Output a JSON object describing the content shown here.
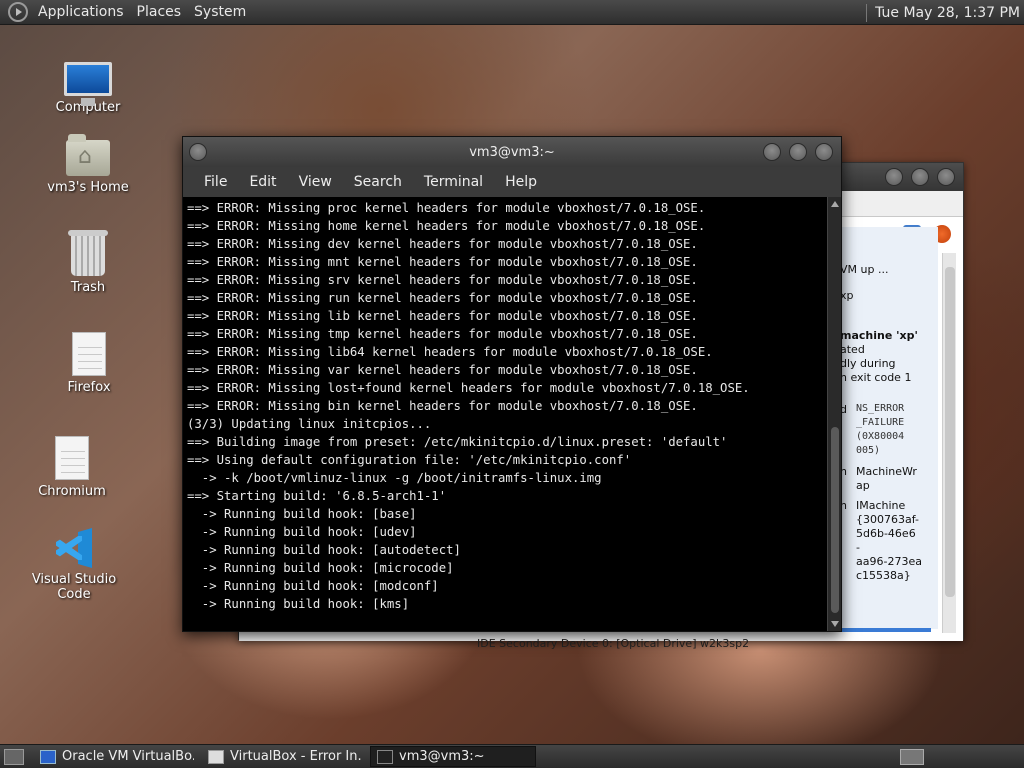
{
  "top_panel": {
    "applications": "Applications",
    "places": "Places",
    "system": "System",
    "clock": "Tue May 28,  1:37 PM"
  },
  "desktop_icons": [
    {
      "label": "Computer",
      "icon": "computer-icon"
    },
    {
      "label": "vm3's Home",
      "icon": "home-folder-icon"
    },
    {
      "label": "Trash",
      "icon": "trash-icon"
    },
    {
      "label": "Firefox",
      "icon": "document-icon"
    },
    {
      "label": "Chromium",
      "icon": "document-icon"
    },
    {
      "label": "Visual Studio Code",
      "icon": "vscode-icon"
    }
  ],
  "vbox_window": {
    "panel_lines": [
      "VM up ...",
      "xp",
      "machine 'xp'",
      "ated",
      "dly during",
      "h exit code 1",
      "d",
      "n",
      "n"
    ],
    "error_code_lines": [
      "NS_ERROR",
      "_FAILURE",
      "(0X80004",
      "005)"
    ],
    "wrap_lines": [
      "MachineWr",
      "ap"
    ],
    "imachine_lines": [
      "IMachine",
      "{300763af-",
      "5d6b-46e6",
      "-",
      "aa96-273ea",
      "c15538a}"
    ],
    "bottom_text": "IDE Secondary Device 0:    [Optical Drive] w2k3sp2"
  },
  "terminal": {
    "title": "vm3@vm3:~",
    "menu": [
      "File",
      "Edit",
      "View",
      "Search",
      "Terminal",
      "Help"
    ],
    "lines": [
      "==> ERROR: Missing proc kernel headers for module vboxhost/7.0.18_OSE.",
      "==> ERROR: Missing home kernel headers for module vboxhost/7.0.18_OSE.",
      "==> ERROR: Missing dev kernel headers for module vboxhost/7.0.18_OSE.",
      "==> ERROR: Missing mnt kernel headers for module vboxhost/7.0.18_OSE.",
      "==> ERROR: Missing srv kernel headers for module vboxhost/7.0.18_OSE.",
      "==> ERROR: Missing run kernel headers for module vboxhost/7.0.18_OSE.",
      "==> ERROR: Missing lib kernel headers for module vboxhost/7.0.18_OSE.",
      "==> ERROR: Missing tmp kernel headers for module vboxhost/7.0.18_OSE.",
      "==> ERROR: Missing lib64 kernel headers for module vboxhost/7.0.18_OSE.",
      "==> ERROR: Missing var kernel headers for module vboxhost/7.0.18_OSE.",
      "==> ERROR: Missing lost+found kernel headers for module vboxhost/7.0.18_OSE.",
      "==> ERROR: Missing bin kernel headers for module vboxhost/7.0.18_OSE.",
      "(3/3) Updating linux initcpios...",
      "==> Building image from preset: /etc/mkinitcpio.d/linux.preset: 'default'",
      "==> Using default configuration file: '/etc/mkinitcpio.conf'",
      "  -> -k /boot/vmlinuz-linux -g /boot/initramfs-linux.img",
      "==> Starting build: '6.8.5-arch1-1'",
      "  -> Running build hook: [base]",
      "  -> Running build hook: [udev]",
      "  -> Running build hook: [autodetect]",
      "  -> Running build hook: [microcode]",
      "  -> Running build hook: [modconf]",
      "  -> Running build hook: [kms]"
    ]
  },
  "taskbar": {
    "items": [
      {
        "label": "Oracle VM VirtualBo...",
        "icon": "virtualbox-icon",
        "active": false
      },
      {
        "label": "VirtualBox - Error In...",
        "icon": "window-icon",
        "active": false
      },
      {
        "label": "vm3@vm3:~",
        "icon": "terminal-icon",
        "active": true
      }
    ]
  }
}
